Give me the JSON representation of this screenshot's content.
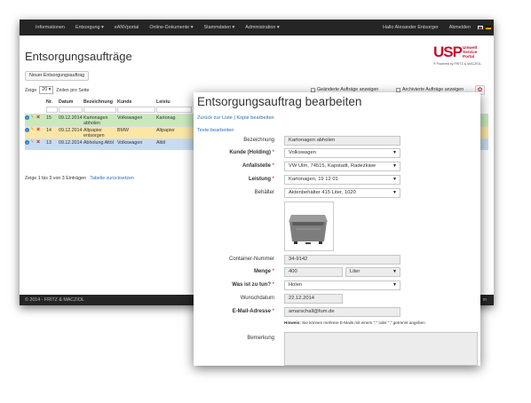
{
  "back": {
    "nav": {
      "items": [
        "Informationen",
        "Entsorgung ▾",
        "eANVportal",
        "Online-Dokumente ▾",
        "Stammdaten ▾",
        "Administration ▾"
      ],
      "user": "Hallo Alexander Entsorger",
      "logout": "Abmelden"
    },
    "title": "Entsorgungsaufträge",
    "logo": {
      "brand": "USP",
      "tag1": "Umwelt",
      "tag2": "Service",
      "tag3": "Portal",
      "powered": "® Powered by FRITZ & MACZIOL"
    },
    "new_button": "Neuer Entsorgungsauftrag",
    "page_size": {
      "prefix": "Zeige",
      "value": "20",
      "suffix": "Zeilen pro Seite"
    },
    "show_changed": "Geänderte Aufträge anzeigen",
    "show_archived": "Archivierte Aufträge anzeigen",
    "table": {
      "headers": {
        "nr": "Nr.",
        "datum": "Datum",
        "bez": "Bezeichnung",
        "kunde": "Kunde",
        "leistung": "Leistu"
      },
      "rows": [
        {
          "nr": "15",
          "datum": "09.12.2014",
          "bez": "Kartonagen abholen",
          "kunde": "Volkswagen",
          "leistung": "Kartonag"
        },
        {
          "nr": "14",
          "datum": "09.12.2014",
          "bez": "Altpapier entsorgen",
          "kunde": "BMW",
          "leistung": "Altpapier"
        },
        {
          "nr": "13",
          "datum": "09.12.2014",
          "bez": "Abholung Altöl",
          "kunde": "Volkswagen",
          "leistung": "Altöl"
        }
      ],
      "footer": "Zeige 1 bis 3 von 3 Einträgen",
      "reset": "Tabelle zurücksetzen"
    },
    "footer": "© 2014 - FRITZ & MACZIOL",
    "footer_right": "m"
  },
  "front": {
    "title": "Entsorgungsauftrag bearbeiten",
    "back_link": "Zurück zur Liste",
    "sep": "|",
    "copy_link": "Kopie bearbeiten",
    "texts_link": "Texte bearbeiten",
    "fields": {
      "bezeichnung": {
        "label": "Bezeichnung",
        "value": "Kartonagen abholen"
      },
      "kunde": {
        "label": "Kunde (Holding)",
        "value": "Volkswagen"
      },
      "anfallstelle": {
        "label": "Anfallstelle",
        "value": "VW Ulm, 74515, Kapstadt, Radezkiwe"
      },
      "leistung": {
        "label": "Leistung",
        "value": "Kartonagen, 19 12 01"
      },
      "behaelter": {
        "label": "Behälter",
        "value": "Aktenbehälter 415 Liter, 1020"
      },
      "container": {
        "label": "Container-Nummer",
        "value": "34-9142"
      },
      "menge": {
        "label": "Menge",
        "value": "400",
        "unit": "Liter"
      },
      "was": {
        "label": "Was ist zu tun?",
        "value": "Holen"
      },
      "wunschdatum": {
        "label": "Wunschdatum",
        "value": "22.12.2014"
      },
      "email": {
        "label": "E-Mail-Adresse",
        "value": "amarschall@fum.de"
      },
      "bemerkung": {
        "label": "Bemerkung"
      }
    },
    "required_mark": "*",
    "hint_label": "Hinweis:",
    "hint_text": "Sie können mehrere E-Mails mit einem \";\" oder \",\" getrennt angeben"
  }
}
